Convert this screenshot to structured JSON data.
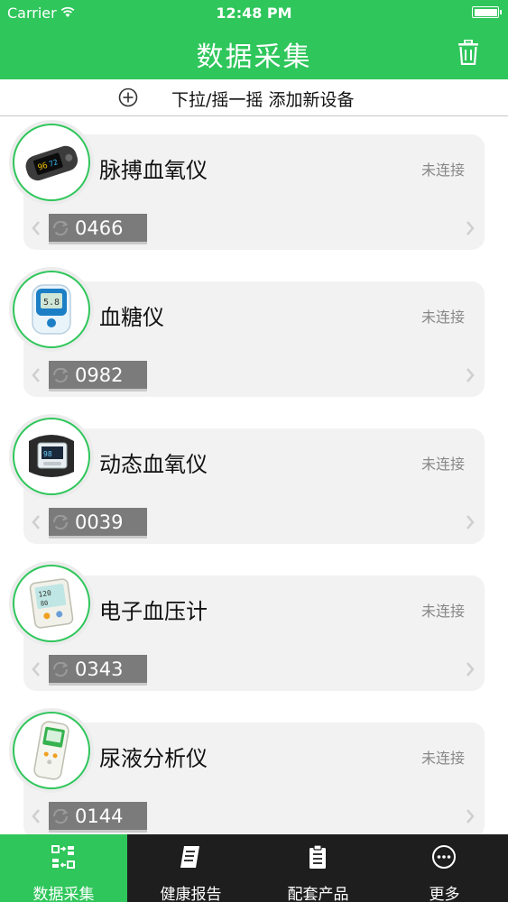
{
  "status_bar": {
    "carrier": "Carrier",
    "time": "12:48 PM"
  },
  "header": {
    "title": "数据采集",
    "trash_icon": "trash-icon"
  },
  "pull_bar": {
    "text": "下拉/摇一摇 添加新设备",
    "icon": "plus-circle-icon"
  },
  "devices": [
    {
      "name": "脉搏血氧仪",
      "status": "未连接",
      "serial": "0466",
      "image": "pulse-oximeter-image"
    },
    {
      "name": "血糖仪",
      "status": "未连接",
      "serial": "0982",
      "image": "glucose-meter-image"
    },
    {
      "name": "动态血氧仪",
      "status": "未连接",
      "serial": "0039",
      "image": "wrist-oximeter-image"
    },
    {
      "name": "电子血压计",
      "status": "未连接",
      "serial": "0343",
      "image": "blood-pressure-monitor-image"
    },
    {
      "name": "尿液分析仪",
      "status": "未连接",
      "serial": "0144",
      "image": "urine-analyzer-image"
    }
  ],
  "tabs": [
    {
      "label": "数据采集",
      "icon": "data-collect-icon",
      "active": true
    },
    {
      "label": "健康报告",
      "icon": "report-icon",
      "active": false
    },
    {
      "label": "配套产品",
      "icon": "products-icon",
      "active": false
    },
    {
      "label": "更多",
      "icon": "more-icon",
      "active": false
    }
  ],
  "colors": {
    "accent": "#2fc65b",
    "tabbar": "#1e1e1e",
    "card": "#f2f2f2"
  }
}
